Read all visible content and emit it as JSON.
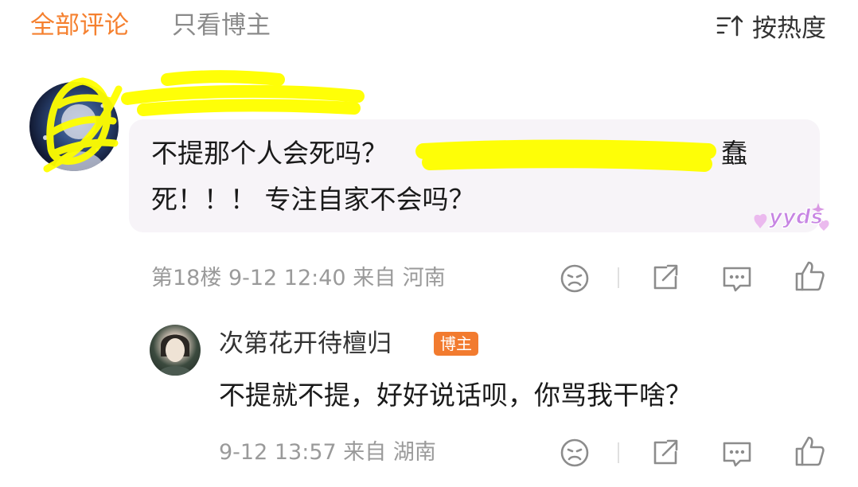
{
  "tabs": {
    "all_comments": "全部评论",
    "blogger_only": "只看博主",
    "sort_label": "按热度"
  },
  "comment": {
    "text_line1_visible": "不提那个人会死吗？",
    "text_line1_end": "蠢",
    "text_line2": "死！！！ 专注自家不会吗？",
    "sticker": "yyds",
    "meta": "第18楼 9-12 12:40 来自 河南"
  },
  "reply": {
    "author": "次第花开待檀归",
    "badge": "博主",
    "text": "不提就不提，好好说话呗，你骂我干啥？",
    "meta": "9-12 13:57 来自 湖南"
  },
  "icons": {
    "sort": "sort-icon",
    "dislike": "frown-icon",
    "share": "share-icon",
    "comment": "comment-icon",
    "like": "thumbs-up-icon"
  },
  "colors": {
    "accent": "#f5802f",
    "badge": "#f27b2f",
    "redaction": "#ffff00",
    "bubble_bg": "#f7f4f8",
    "meta_text": "#9a9a9a"
  }
}
